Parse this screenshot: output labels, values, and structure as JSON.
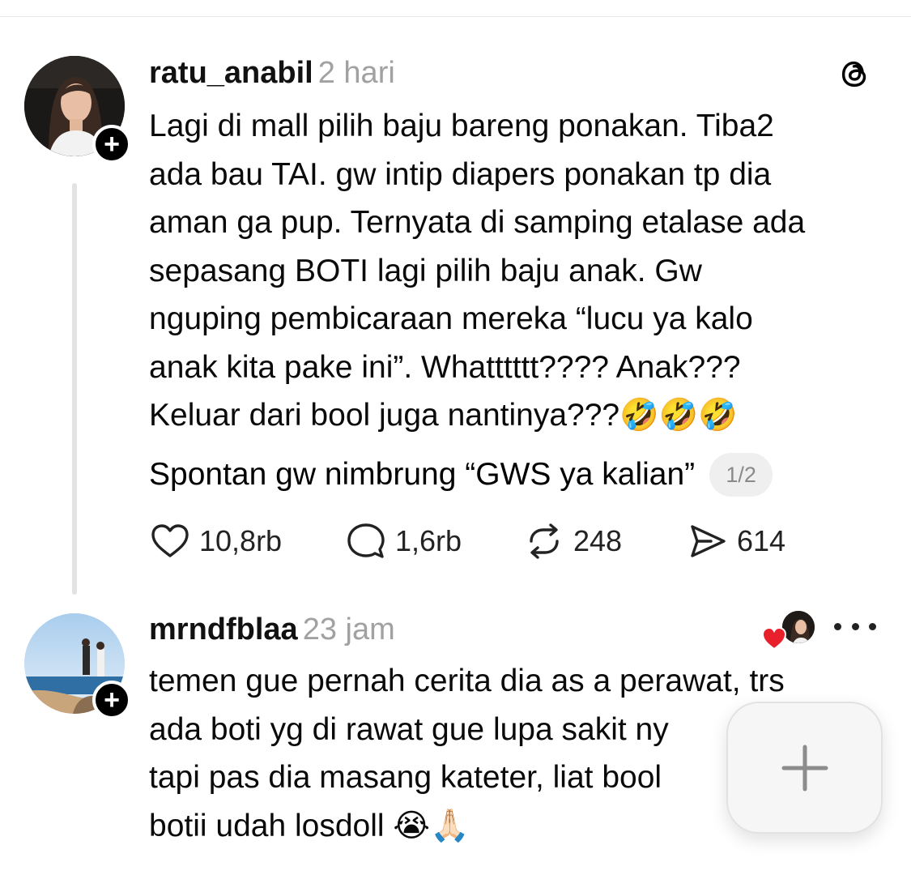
{
  "posts": [
    {
      "username": "ratu_anabil",
      "time": "2 hari",
      "body": "Lagi di mall pilih baju bareng ponakan. Tiba2\nada bau TAI. gw intip diapers ponakan tp dia\naman ga pup. Ternyata di samping etalase ada\nsepasang BOTI lagi pilih baju anak. Gw\nnguping pembicaraan mereka “lucu ya kalo\nanak kita pake ini”. Whatttttt???? Anak???\nKeluar dari bool juga nantinya???🤣🤣🤣",
      "body_extra": "Spontan gw nimbrung “GWS ya kalian”",
      "page_indicator": "1/2",
      "stats": {
        "likes": "10,8rb",
        "comments": "1,6rb",
        "reposts": "248",
        "shares": "614"
      }
    },
    {
      "username": "mrndfblaa",
      "time": "23 jam",
      "body": "temen gue pernah cerita dia as a perawat, trs\nada boti yg di rawat gue lupa sakit ny\ntapi pas dia masang kateter, liat bool\nbotii udah losdoll 😭🙏🏻"
    }
  ],
  "icons": {
    "brand": "threads-logo-icon",
    "follow": "plus-icon",
    "like": "heart-outline-icon",
    "comment": "comment-bubble-icon",
    "repost": "repost-arrows-icon",
    "share": "send-icon",
    "more": "more-horizontal-icon",
    "compose": "plus-icon"
  },
  "colors": {
    "liked_heart": "#e8202c",
    "muted_text": "#a1a1a1"
  }
}
